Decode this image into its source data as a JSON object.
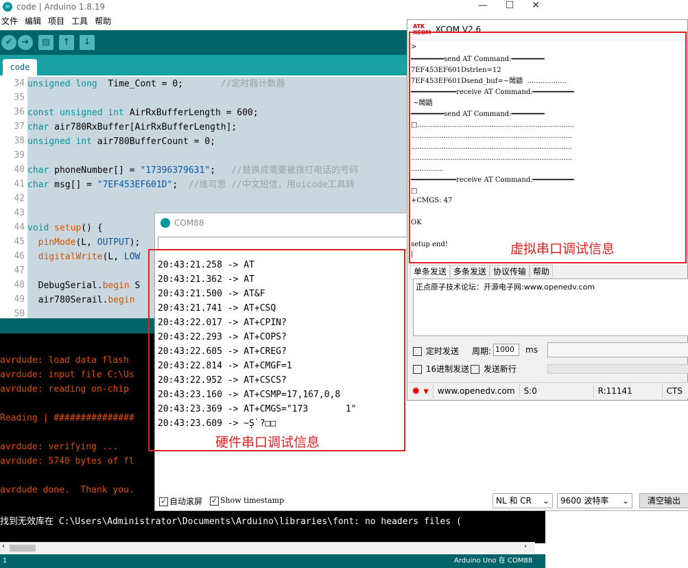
{
  "arduino": {
    "title": "code | Arduino 1.8.19",
    "menu": [
      "文件",
      "编辑",
      "项目",
      "工具",
      "帮助"
    ],
    "tab": "code",
    "lines": [
      {
        "n": "34",
        "html": "<span class=\"kw\">unsigned long</span>  Time_Cont = 0;       <span class=\"cm\">//定时器计数器</span>"
      },
      {
        "n": "35",
        "html": ""
      },
      {
        "n": "36",
        "html": "<span class=\"kw\">const unsigned int</span> AirRxBufferLength = 600;"
      },
      {
        "n": "37",
        "html": "<span class=\"kw\">char</span> air780RxBuffer[AirRxBufferLength];"
      },
      {
        "n": "38",
        "html": "<span class=\"kw\">unsigned int</span> air780BufferCount = 0;"
      },
      {
        "n": "39",
        "html": ""
      },
      {
        "n": "40",
        "html": "<span class=\"kw\">char</span> phoneNumber[] = <span class=\"st\">\"17396379631\"</span>;   <span class=\"cm\">//替换成需要被拨打电话的号码</span>"
      },
      {
        "n": "41",
        "html": "<span class=\"kw\">char</span> msg[] = <span class=\"st\">\"7EF453EF601D\"</span>;  <span class=\"cm\">//维可思 //中文短信，用uicode工具转</span>"
      },
      {
        "n": "42",
        "html": ""
      },
      {
        "n": "43",
        "html": ""
      },
      {
        "n": "44",
        "html": "<span class=\"kw\">void</span> <span class=\"fn\">setup</span>() {"
      },
      {
        "n": "45",
        "html": "  <span class=\"fn\">pinMode</span>(L, <span class=\"st\">OUTPUT</span>);"
      },
      {
        "n": "46",
        "html": "  <span class=\"fn\">digitalWrite</span>(L, <span class=\"st\">LOW</span>"
      },
      {
        "n": "47",
        "html": ""
      },
      {
        "n": "48",
        "html": "  DebugSerial.<span class=\"fn\">begin</span> S"
      },
      {
        "n": "49",
        "html": "  air780Serail.<span class=\"fn\">begin</span>"
      },
      {
        "n": "50",
        "html": ""
      }
    ],
    "console": [
      {
        "t": "avrdude: load data flash",
        "w": false
      },
      {
        "t": "avrdude: input file C:\\Us",
        "w": false
      },
      {
        "t": "avrdude: reading on-chip",
        "w": false
      },
      {
        "t": "",
        "w": false
      },
      {
        "t": "Reading | ###############",
        "w": false
      },
      {
        "t": "",
        "w": false
      },
      {
        "t": "avrdude: verifying ...",
        "w": false
      },
      {
        "t": "avrdude: 5740 bytes of fl",
        "w": false
      },
      {
        "t": "",
        "w": false
      },
      {
        "t": "avrdude done.  Thank you.",
        "w": false
      },
      {
        "t": "",
        "w": false
      },
      {
        "t": "找到无效库在 C:\\Users\\Administrator\\Documents\\Arduino\\libraries\\font: no headers files (",
        "w": true
      }
    ],
    "status_left": "1",
    "status_right": "Arduino Uno 在 COM88"
  },
  "com": {
    "title": "COM88",
    "log": [
      "20:43:21.258 -> AT",
      "20:43:21.362 -> AT",
      "20:43:21.500 -> AT&F",
      "20:43:21.741 -> AT+CSQ",
      "20:43:22.017 -> AT+CPIN?",
      "20:43:22.293 -> AT+COPS?",
      "20:43:22.605 -> AT+CREG?",
      "20:43:22.814 -> AT+CMGF=1",
      "20:43:22.952 -> AT+CSCS?",
      "20:43:23.160 -> AT+CSMP=17,167,0,8",
      "20:43:23.369 -> AT+CMGS=\"173       1\"",
      "20:43:23.609 -> ~Ș`?□□"
    ],
    "autoscroll": "自动滚屏",
    "timestamp": "Show timestamp",
    "line_ending": "NL 和 CR",
    "baud": "9600 波特率",
    "clear": "清空输出",
    "annotation": "硬件串口调试信息"
  },
  "xcom": {
    "title": "XCOM V2.6",
    "recv": [
      ">",
      "━━━━━━━━send AT Command:━━━━━━━━",
      "7EF453EF601Dstrlen=12",
      "7EF453EF601Dsend_buf=~鬧鼯  ..................",
      "━━━━━━━━━━━receive AT Command:━━━━━━━━━━",
      " ~鬧鼯",
      "━━━━━━━━send AT Command:━━━━━━━━",
      "□........................................................................",
      "..........................................................................",
      "..........................................................................",
      "..........................................................................",
      "...............",
      "━━━━━━━━━━━receive AT Command:━━━━━━━━━━",
      "□",
      "+CMGS: 47",
      "",
      "OK",
      "",
      "setup end!",
      "|"
    ],
    "tabs": [
      "单条发送",
      "多条发送",
      "协议传输",
      "帮助"
    ],
    "send_text": "正点原子技术论坛：开源电子网:www.openedv.com",
    "timed_send": "定时发送",
    "period_label": "周期:",
    "period_value": "1000",
    "ms": "ms",
    "hex_send": "16进制发送",
    "newline": "发送新行",
    "site": "www.openedv.com",
    "s": "S:0",
    "r": "R:11141",
    "cts": "CTS",
    "annotation": "虚拟串口调试信息"
  }
}
